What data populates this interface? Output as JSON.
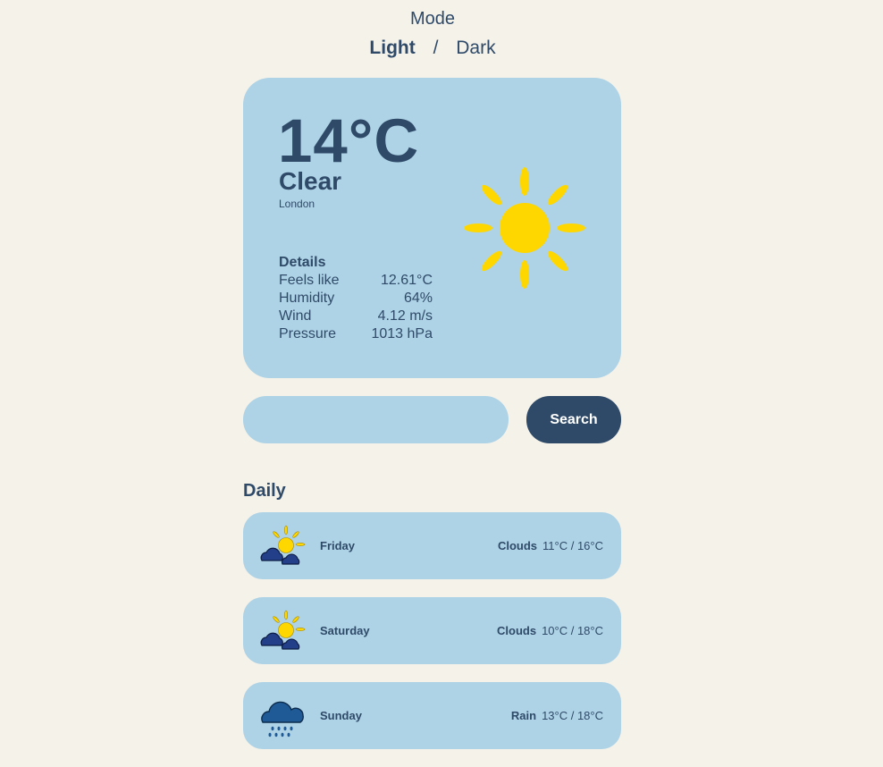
{
  "mode": {
    "title": "Mode",
    "light": "Light",
    "separator": "/",
    "dark": "Dark"
  },
  "current": {
    "temperature": "14°C",
    "condition": "Clear",
    "city": "London",
    "icon": "sun-icon",
    "details_title": "Details",
    "details": [
      {
        "label": "Feels like",
        "value": "12.61°C"
      },
      {
        "label": "Humidity",
        "value": "64%"
      },
      {
        "label": "Wind",
        "value": "4.12 m/s"
      },
      {
        "label": "Pressure",
        "value": "1013 hPa"
      }
    ]
  },
  "search": {
    "value": "",
    "placeholder": "",
    "button_label": "Search"
  },
  "daily": {
    "title": "Daily",
    "days": [
      {
        "day": "Friday",
        "condition": "Clouds",
        "range": "11°C / 16°C",
        "icon": "sun-behind-clouds-icon"
      },
      {
        "day": "Saturday",
        "condition": "Clouds",
        "range": "10°C / 18°C",
        "icon": "sun-behind-clouds-icon"
      },
      {
        "day": "Sunday",
        "condition": "Rain",
        "range": "13°C / 18°C",
        "icon": "rain-cloud-icon"
      }
    ]
  },
  "colors": {
    "background": "#f5f2ea",
    "card": "#aed3e6",
    "text": "#2f4a68",
    "sun": "#ffd700",
    "cloud": "#1e3a7a"
  }
}
